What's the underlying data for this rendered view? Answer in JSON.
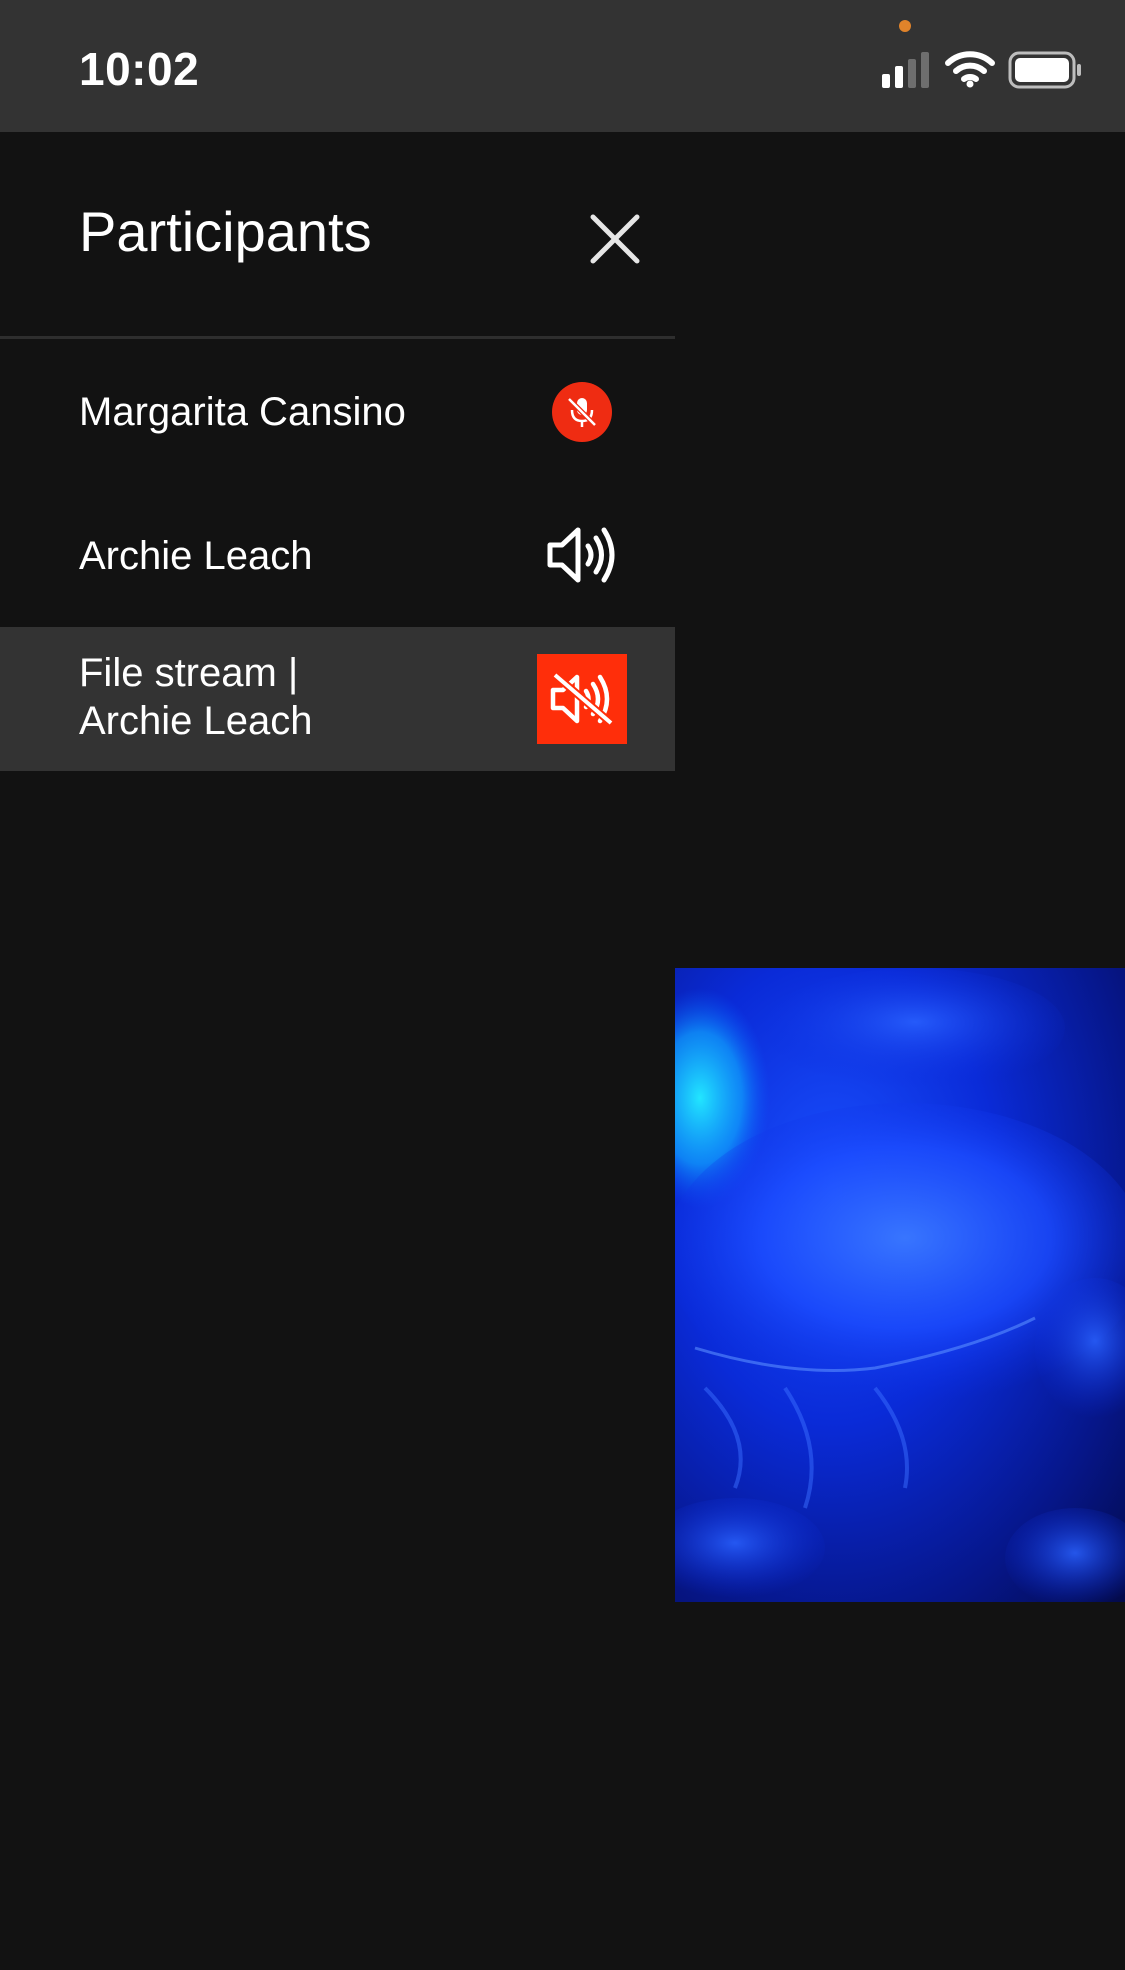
{
  "status_bar": {
    "time": "10:02",
    "privacy_indicator_color": "#e0832a",
    "icons": [
      "cellular-signal-icon",
      "wifi-icon",
      "battery-icon"
    ]
  },
  "panel": {
    "title": "Participants",
    "close_icon": "close-icon",
    "participants": [
      {
        "name": "Margarita Cansino",
        "status_icon": "microphone-muted-icon",
        "status_color": "#ef2c12",
        "highlighted": false
      },
      {
        "name": "Archie Leach",
        "status_icon": "speaker-icon",
        "highlighted": false
      },
      {
        "name_line1": "File stream |",
        "name_line2": "Archie Leach",
        "status_icon": "speaker-muted-icon",
        "status_color": "#ff2e0a",
        "highlighted": true
      }
    ]
  },
  "video": {
    "content": "jellyfish video stream"
  }
}
